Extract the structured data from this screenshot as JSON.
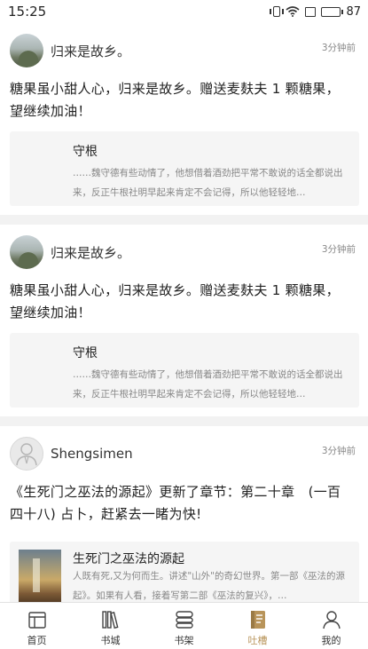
{
  "status": {
    "time": "15:25",
    "battery": "87",
    "battery_level": 0.87
  },
  "feed": [
    {
      "username": "归来是故乡。",
      "time_ago": "3分钟前",
      "message": "糖果虽小甜人心，归来是故乡。赠送麦麸夫 1 颗糖果，望继续加油！",
      "book": {
        "title": "守根",
        "excerpt": "……魏守德有些动情了，他想借着酒劲把平常不敢说的话全都说出来，反正牛根社明早起来肯定不会记得，所以他轻轻地…"
      }
    },
    {
      "username": "归来是故乡。",
      "time_ago": "3分钟前",
      "message": "糖果虽小甜人心，归来是故乡。赠送麦麸夫 1 颗糖果，望继续加油！",
      "book": {
        "title": "守根",
        "excerpt": "……魏守德有些动情了，他想借着酒劲把平常不敢说的话全都说出来，反正牛根社明早起来肯定不会记得，所以他轻轻地…"
      }
    },
    {
      "username": "Shengsimen",
      "time_ago": "3分钟前",
      "message": "《生死门之巫法的源起》更新了章节：第二十章　(一百四十八) 占卜，赶紧去一睹为快!",
      "book": {
        "title": "生死门之巫法的源起",
        "excerpt": "人既有死,又为何而生。讲述\"山外\"的奇幻世界。第一部《巫法的源起》。如果有人看，接着写第二部《巫法的复兴》，…"
      }
    }
  ],
  "tabs": [
    {
      "label": "首页",
      "icon": "home-icon"
    },
    {
      "label": "书城",
      "icon": "bookstore-icon"
    },
    {
      "label": "书架",
      "icon": "bookshelf-icon"
    },
    {
      "label": "吐槽",
      "icon": "comment-book-icon",
      "active": true
    },
    {
      "label": "我的",
      "icon": "profile-icon"
    }
  ],
  "colors": {
    "accent": "#b8945a",
    "background": "#f2f2f2",
    "muted_text": "#888888"
  }
}
